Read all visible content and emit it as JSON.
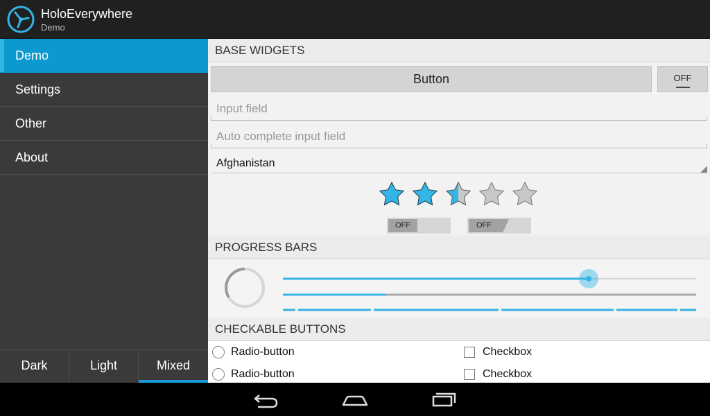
{
  "app": {
    "title": "HoloEverywhere",
    "subtitle": "Demo",
    "logo_icon": "holo-logo-icon"
  },
  "drawer": {
    "items": [
      {
        "label": "Demo",
        "active": true
      },
      {
        "label": "Settings"
      },
      {
        "label": "Other"
      },
      {
        "label": "About"
      }
    ],
    "themes": [
      {
        "label": "Dark"
      },
      {
        "label": "Light"
      },
      {
        "label": "Mixed",
        "active": true
      }
    ]
  },
  "base_widgets": {
    "header": "BASE WIDGETS",
    "button_label": "Button",
    "toggle_label": "OFF",
    "input_placeholder": "Input field",
    "autocomplete_placeholder": "Auto complete input field",
    "spinner_value": "Afghanistan",
    "rating": {
      "value": 2.5,
      "max": 5
    },
    "switches": [
      {
        "label": "OFF"
      },
      {
        "label": "OFF"
      }
    ]
  },
  "progress": {
    "header": "PROGRESS BARS",
    "seekbar_fraction": 0.74,
    "progress_fraction": 0.25,
    "secondary_fraction": 1.0
  },
  "checkable": {
    "header": "CHECKABLE BUTTONS",
    "radios": [
      "Radio-button",
      "Radio-button"
    ],
    "checkboxes": [
      "Checkbox",
      "Checkbox"
    ]
  },
  "colors": {
    "accent": "#33b5e5",
    "drawer_active": "#0b99cf",
    "action_bar": "#202020"
  },
  "navbar": {
    "icons": [
      "back-icon",
      "home-icon",
      "recents-icon"
    ]
  }
}
